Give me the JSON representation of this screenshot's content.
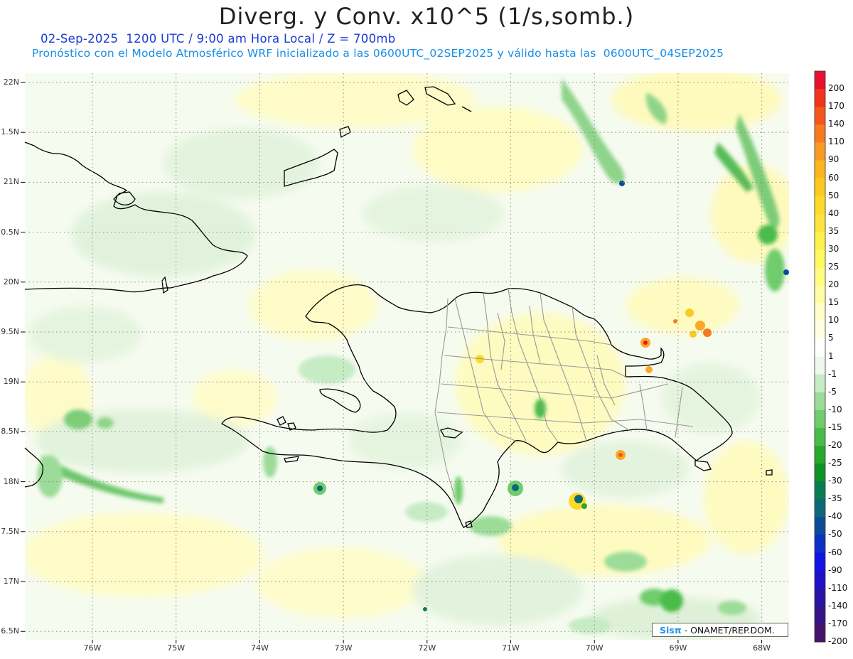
{
  "header": {
    "title": "Diverg. y Conv. x10^5 (1/s,somb.)",
    "subtitle1": "02-Sep-2025  1200 UTC / 9:00 am Hora Local / Z = 700mb",
    "subtitle2": "Pronóstico con el Modelo Atmosférico WRF inicializado a las 0600UTC_02SEP2025 y válido hasta las  0600UTC_04SEP2025"
  },
  "axes": {
    "lat_labels": [
      "22N",
      "1.5N",
      "21N",
      "0.5N",
      "20N",
      "9.5N",
      "19N",
      "8.5N",
      "18N",
      "7.5N",
      "17N",
      "6.5N"
    ],
    "lon_labels": [
      "76W",
      "75W",
      "74W",
      "73W",
      "72W",
      "71W",
      "70W",
      "69W",
      "68W"
    ]
  },
  "colorbar": {
    "levels": [
      "200",
      "170",
      "140",
      "110",
      "90",
      "60",
      "50",
      "40",
      "35",
      "30",
      "25",
      "20",
      "15",
      "10",
      "5",
      "1",
      "-1",
      "-5",
      "-10",
      "-15",
      "-20",
      "-25",
      "-30",
      "-35",
      "-40",
      "-50",
      "-60",
      "-90",
      "-110",
      "-140",
      "-170",
      "-200"
    ],
    "colors": [
      "#e8102c",
      "#f2341c",
      "#f5561c",
      "#f77a1e",
      "#f99a24",
      "#fbb61e",
      "#fcca1e",
      "#fdd928",
      "#fee33a",
      "#fef04c",
      "#fff85e",
      "#fffc80",
      "#fffda4",
      "#fffec8",
      "#fffee2",
      "#ffffff",
      "#eef8ec",
      "#c6ecc4",
      "#9cdc98",
      "#70cc6c",
      "#48bc48",
      "#28a82c",
      "#0c9424",
      "#0a7c52",
      "#0a6878",
      "#0a4c9a",
      "#0a30c4",
      "#1414e6",
      "#2010c8",
      "#2a14a4",
      "#361488",
      "#44146c"
    ]
  },
  "credit": {
    "brand": "Sisπ",
    "text": "- ONAMET/REP.DOM."
  }
}
